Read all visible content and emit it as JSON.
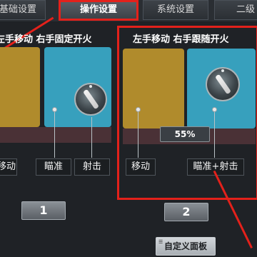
{
  "tabs": [
    {
      "label": "基础设置",
      "active": false
    },
    {
      "label": "操作设置",
      "active": true
    },
    {
      "label": "系统设置",
      "active": false
    },
    {
      "label": "二级",
      "active": false
    }
  ],
  "panels": [
    {
      "title": "左手移动 右手固定开火",
      "labels": [
        "移动",
        "瞄准",
        "射击"
      ],
      "button": "1"
    },
    {
      "title": "左手移动 右手跟随开火",
      "labels": [
        "移动",
        "瞄准+射击"
      ],
      "percent": "55%",
      "button": "2"
    }
  ],
  "custom_panel": {
    "label": "自定义面板",
    "icon": "layout-icon"
  },
  "colors": {
    "highlight": "#e3211b",
    "move_zone": "#b08b2c",
    "aim_zone": "#37a0bd"
  }
}
